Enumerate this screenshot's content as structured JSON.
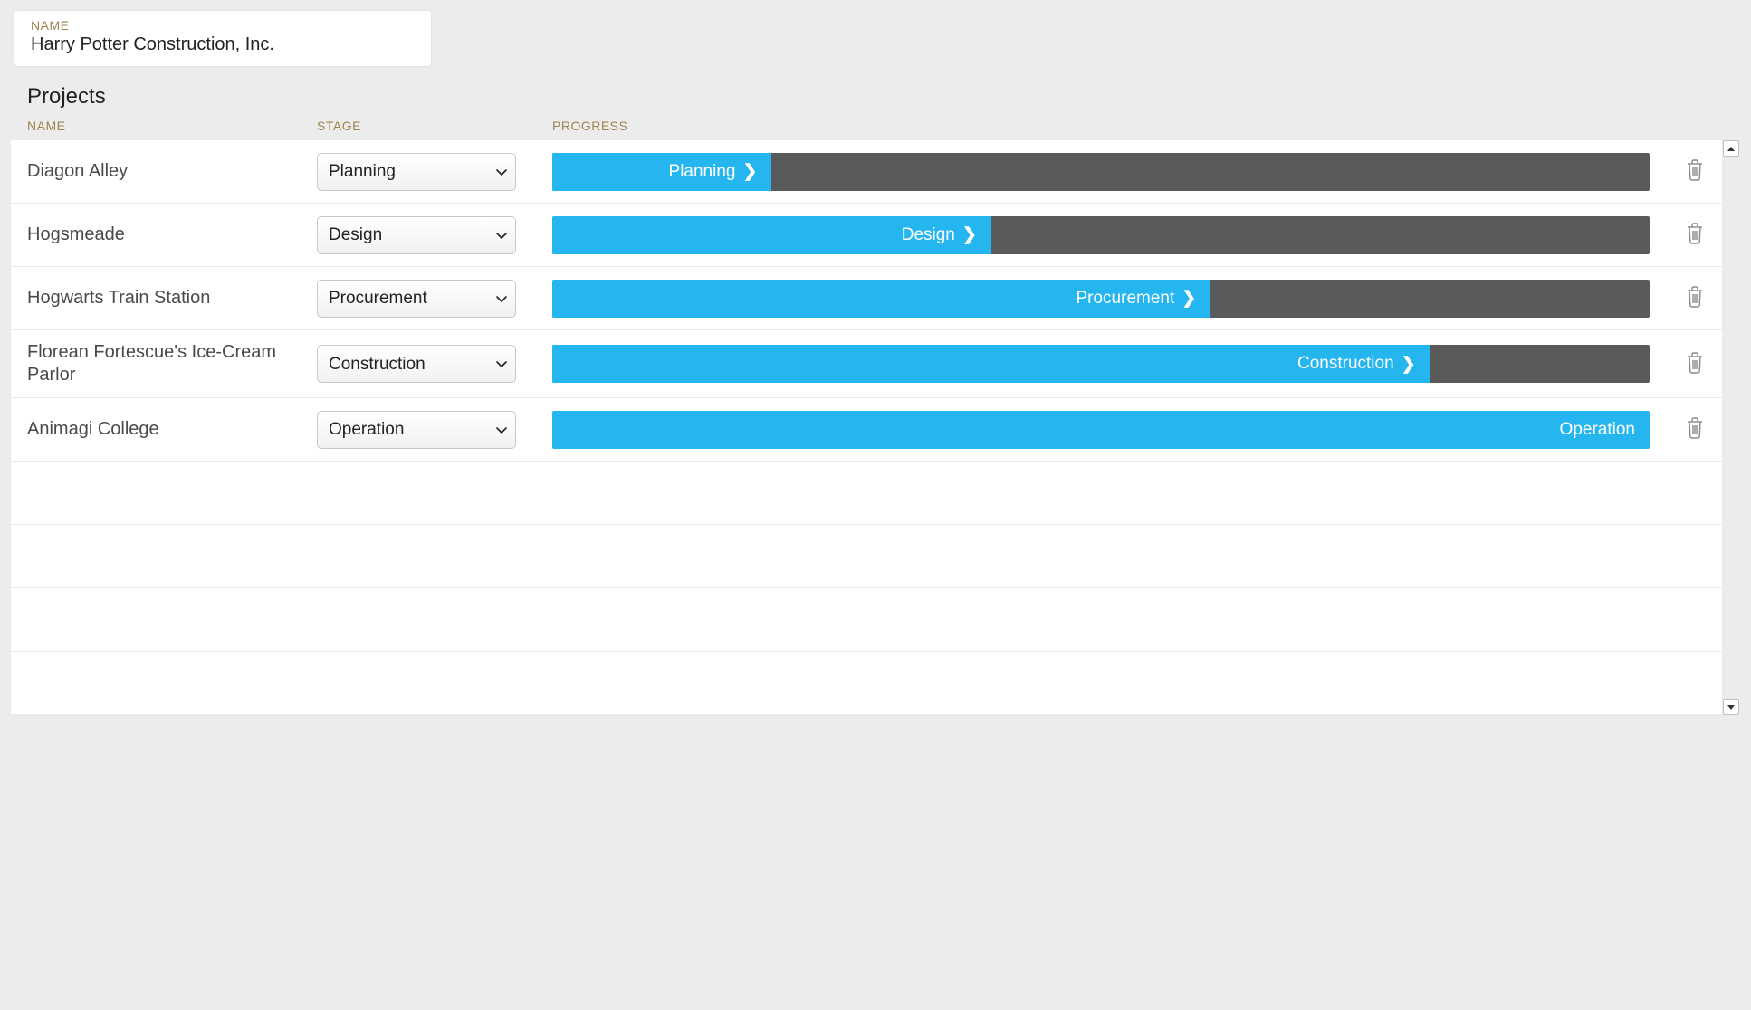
{
  "company": {
    "name_label": "NAME",
    "name_value": "Harry Potter Construction, Inc."
  },
  "section_title": "Projects",
  "columns": {
    "name": "NAME",
    "stage": "STAGE",
    "progress": "PROGRESS"
  },
  "stage_options": [
    "Planning",
    "Design",
    "Procurement",
    "Construction",
    "Operation"
  ],
  "projects": [
    {
      "name": "Diagon Alley",
      "stage": "Planning",
      "progress_pct": 20,
      "show_arrow": true
    },
    {
      "name": "Hogsmeade",
      "stage": "Design",
      "progress_pct": 40,
      "show_arrow": true
    },
    {
      "name": "Hogwarts Train Station",
      "stage": "Procurement",
      "progress_pct": 60,
      "show_arrow": true
    },
    {
      "name": "Florean Fortescue's Ice-Cream Parlor",
      "stage": "Construction",
      "progress_pct": 80,
      "show_arrow": true
    },
    {
      "name": "Animagi College",
      "stage": "Operation",
      "progress_pct": 100,
      "show_arrow": false
    }
  ],
  "empty_rows": 4
}
